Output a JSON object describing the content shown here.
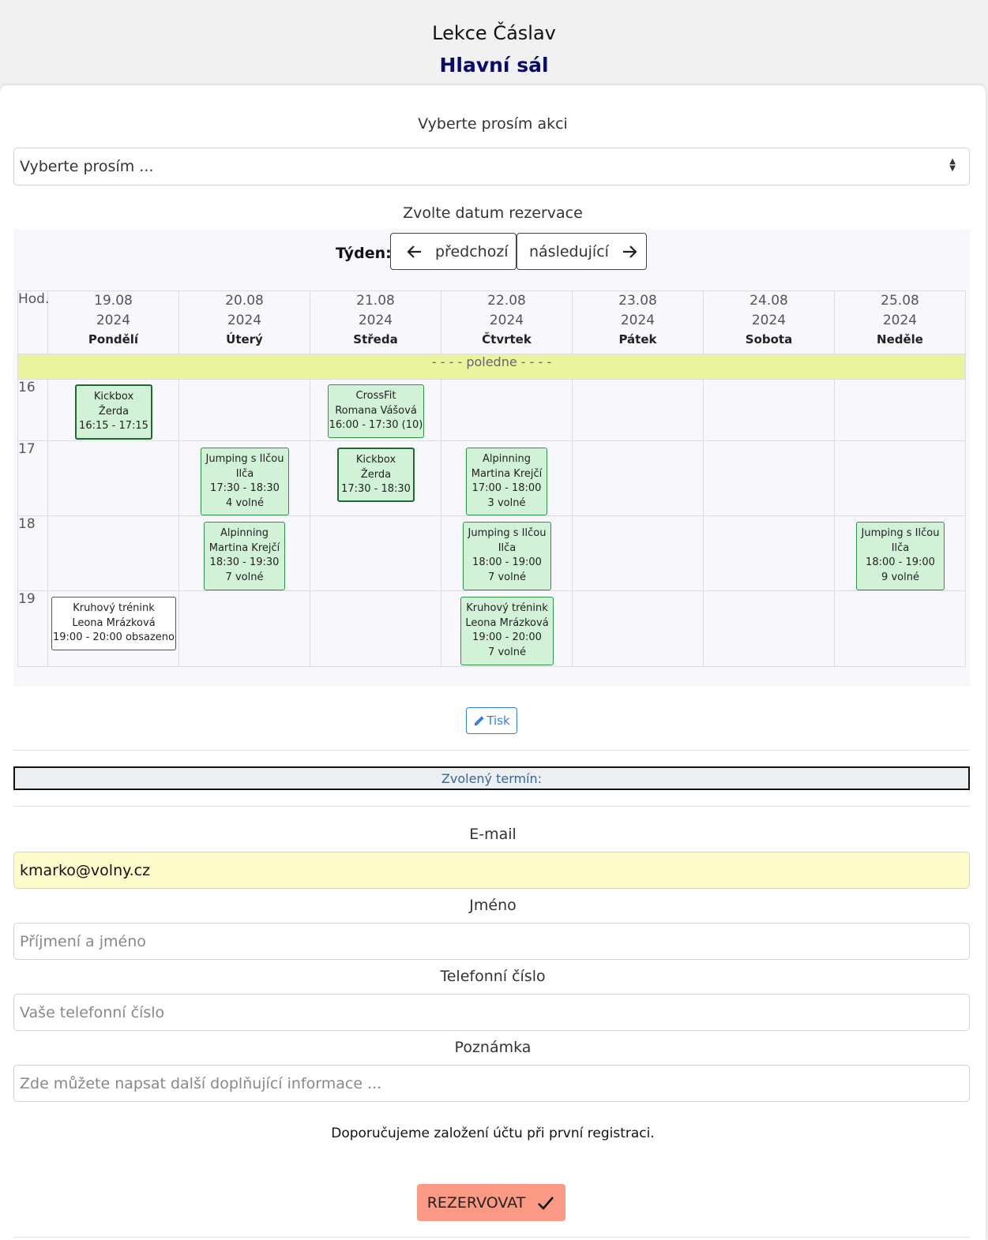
{
  "header": {
    "title": "Lekce Čáslav",
    "subtitle": "Hlavní sál"
  },
  "event_select": {
    "label": "Vyberte prosím akci",
    "placeholder": "Vyberte prosím ..."
  },
  "calendar": {
    "label": "Zvolte datum rezervace",
    "week_label": "Týden:",
    "prev_label": "předchozí",
    "next_label": "následující",
    "hour_header": "Hod.",
    "noon_label": "- - - - poledne - - - -",
    "days": [
      {
        "date": "19.08",
        "year": "2024",
        "name": "Pondělí"
      },
      {
        "date": "20.08",
        "year": "2024",
        "name": "Úterý"
      },
      {
        "date": "21.08",
        "year": "2024",
        "name": "Středa"
      },
      {
        "date": "22.08",
        "year": "2024",
        "name": "Čtvrtek"
      },
      {
        "date": "23.08",
        "year": "2024",
        "name": "Pátek"
      },
      {
        "date": "24.08",
        "year": "2024",
        "name": "Sobota"
      },
      {
        "date": "25.08",
        "year": "2024",
        "name": "Neděle"
      }
    ],
    "hours": [
      "16",
      "17",
      "18",
      "19"
    ],
    "events": [
      {
        "lines": [
          "Kickbox",
          "Žerda",
          "16:15 - 17:15"
        ],
        "status": "selected"
      },
      {
        "lines": [
          "CrossFit",
          "Romana Vášová",
          "16:00 - 17:30 (10)"
        ],
        "status": "available"
      },
      {
        "lines": [
          "Jumping s Ilčou",
          "Ilča",
          "17:30 - 18:30",
          "4 volné"
        ],
        "status": "available"
      },
      {
        "lines": [
          "Kickbox",
          "Žerda",
          "17:30 - 18:30"
        ],
        "status": "selected"
      },
      {
        "lines": [
          "Alpinning",
          "Martina Krejčí",
          "17:00 - 18:00",
          "3 volné"
        ],
        "status": "available"
      },
      {
        "lines": [
          "Alpinning",
          "Martina Krejčí",
          "18:30 - 19:30",
          "7 volné"
        ],
        "status": "available"
      },
      {
        "lines": [
          "Jumping s Ilčou",
          "Ilča",
          "18:00 - 19:00",
          "7 volné"
        ],
        "status": "available"
      },
      {
        "lines": [
          "Jumping s Ilčou",
          "Ilča",
          "18:00 - 19:00",
          "9 volné"
        ],
        "status": "available"
      },
      {
        "lines": [
          "Kruhový trénink",
          "Leona Mrázková",
          "19:00 - 20:00 obsazeno"
        ],
        "status": "full"
      },
      {
        "lines": [
          "Kruhový trénink",
          "Leona Mrázková",
          "19:00 - 20:00",
          "7 volné"
        ],
        "status": "available"
      }
    ]
  },
  "print_label": "Tisk",
  "chosen_label": "Zvolený termín:",
  "form": {
    "email": {
      "label": "E-mail",
      "value": "kmarko@volny.cz"
    },
    "name": {
      "label": "Jméno",
      "placeholder": "Příjmení a jméno"
    },
    "phone": {
      "label": "Telefonní číslo",
      "placeholder": "Vaše telefonní číslo"
    },
    "note": {
      "label": "Poznámka",
      "placeholder": "Zde můžete napsat další doplňující informace ..."
    }
  },
  "recommendation": "Doporučujeme založení účtu při první registraci.",
  "submit_label": "REZERVOVAT",
  "colors": {
    "room_title": "#0a0a6b",
    "noon_bar": "#eaf39e",
    "event_bg": "#d2f2d8",
    "event_border": "#2d9445",
    "email_bg": "#fefccb",
    "submit_bg": "#fa9a85",
    "print_accent": "#2f80ed"
  }
}
